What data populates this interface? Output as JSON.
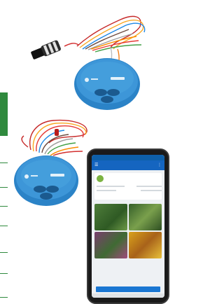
{
  "colors": {
    "brand_blue": "#1f6fb5",
    "controller_blue": "#2b83c7",
    "table_green": "#2f8a3e",
    "app_blue": "#1565c0"
  },
  "icons": [
    "menu-icon",
    "more-icon"
  ],
  "app": {
    "status_time": "",
    "title": "",
    "card_name": "",
    "card_link": "",
    "tile_labels": [
      "",
      "",
      "",
      ""
    ],
    "button_label": ""
  }
}
